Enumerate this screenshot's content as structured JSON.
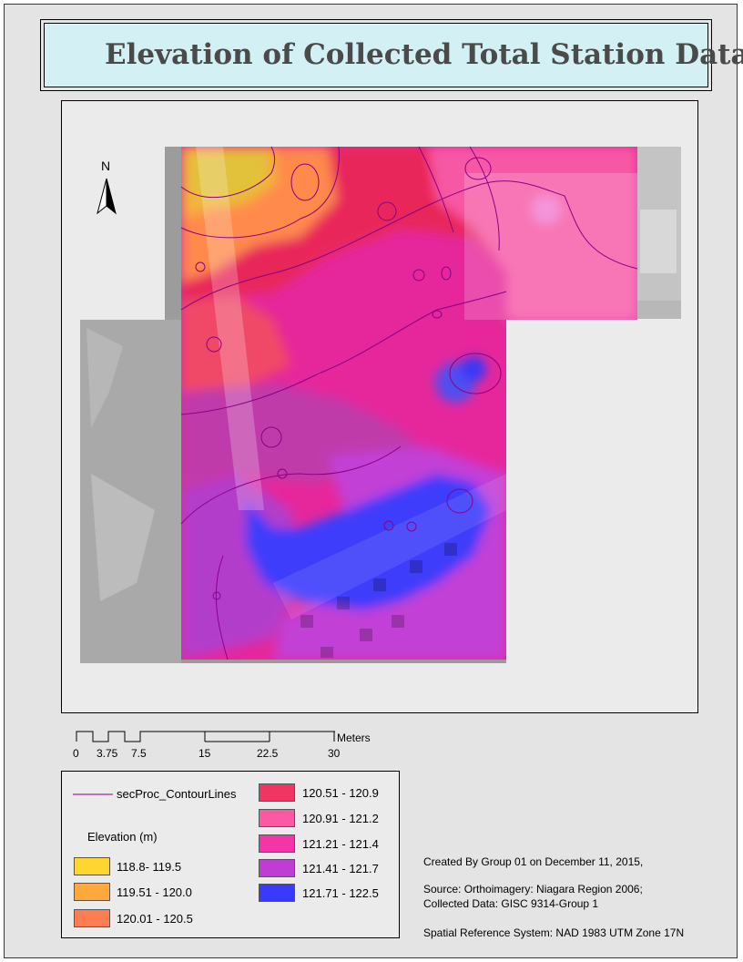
{
  "title": "Elevation of Collected Total Station Data",
  "north_arrow": {
    "label": "N"
  },
  "scale_bar": {
    "unit": "Meters",
    "ticks": [
      "0",
      "3.75",
      "7.5",
      "15",
      "22.5",
      "30"
    ]
  },
  "legend": {
    "contour_label": "secProc_ContourLines",
    "contour_color": "#8b0085",
    "elevation_title": "Elevation (m)",
    "classes": [
      {
        "label": "118.8- 119.5",
        "color": "#ffd531"
      },
      {
        "label": "119.51 - 120.0",
        "color": "#ffa83d"
      },
      {
        "label": "120.01 - 120.5",
        "color": "#ff7d52"
      },
      {
        "label": "120.51 - 120.9",
        "color": "#f03562"
      },
      {
        "label": "120.91 - 121.2",
        "color": "#fb5aa3"
      },
      {
        "label": "121.21 - 121.4",
        "color": "#f535a7"
      },
      {
        "label": "121.41 - 121.7",
        "color": "#c03cd4"
      },
      {
        "label": "121.71 - 122.5",
        "color": "#3939ff"
      }
    ]
  },
  "info": {
    "created_by": "Created By Group 01 on December 11, 2015,",
    "source_line1": "Source: Orthoimagery:  Niagara Region 2006;",
    "source_line2": "Collected Data: GISC 9314-Group 1",
    "spatial_ref": "Spatial Reference System: NAD 1983 UTM Zone 17N"
  }
}
